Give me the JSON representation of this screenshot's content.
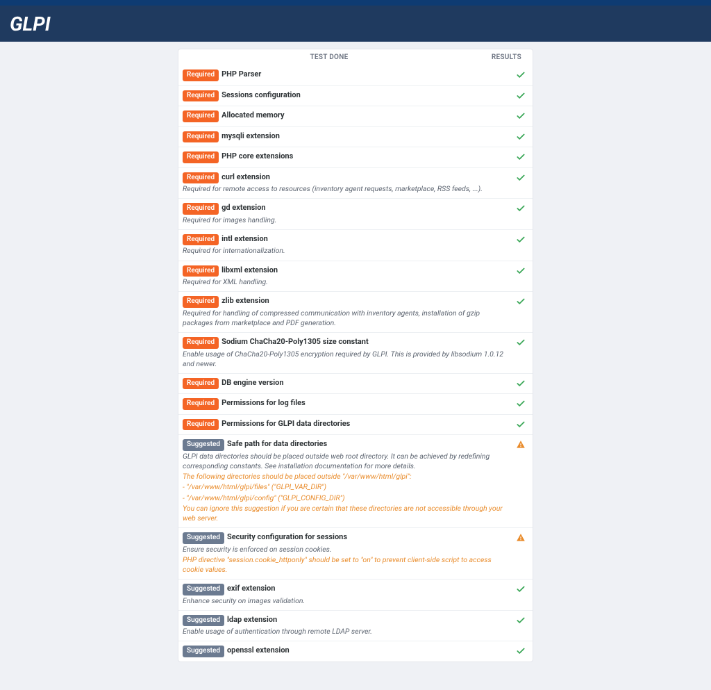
{
  "brand": "GLPI",
  "columns": {
    "test": "TEST DONE",
    "results": "RESULTS"
  },
  "badges": {
    "required": "Required",
    "suggested": "Suggested"
  },
  "rows": [
    {
      "type": "required",
      "title": "PHP Parser",
      "status": "ok"
    },
    {
      "type": "required",
      "title": "Sessions configuration",
      "status": "ok"
    },
    {
      "type": "required",
      "title": "Allocated memory",
      "status": "ok"
    },
    {
      "type": "required",
      "title": "mysqli extension",
      "status": "ok"
    },
    {
      "type": "required",
      "title": "PHP core extensions",
      "status": "ok"
    },
    {
      "type": "required",
      "title": "curl extension",
      "status": "ok",
      "desc": "Required for remote access to resources (inventory agent requests, marketplace, RSS feeds, ...)."
    },
    {
      "type": "required",
      "title": "gd extension",
      "status": "ok",
      "desc": "Required for images handling."
    },
    {
      "type": "required",
      "title": "intl extension",
      "status": "ok",
      "desc": "Required for internationalization."
    },
    {
      "type": "required",
      "title": "libxml extension",
      "status": "ok",
      "desc": "Required for XML handling."
    },
    {
      "type": "required",
      "title": "zlib extension",
      "status": "ok",
      "desc": "Required for handling of compressed communication with inventory agents, installation of gzip packages from marketplace and PDF generation."
    },
    {
      "type": "required",
      "title": "Sodium ChaCha20-Poly1305 size constant",
      "status": "ok",
      "desc": "Enable usage of ChaCha20-Poly1305 encryption required by GLPI. This is provided by libsodium 1.0.12 and newer."
    },
    {
      "type": "required",
      "title": "DB engine version",
      "status": "ok"
    },
    {
      "type": "required",
      "title": "Permissions for log files",
      "status": "ok"
    },
    {
      "type": "required",
      "title": "Permissions for GLPI data directories",
      "status": "ok"
    },
    {
      "type": "suggested",
      "title": "Safe path for data directories",
      "status": "warn",
      "desc": "GLPI data directories should be placed outside web root directory. It can be achieved by redefining corresponding constants. See installation documentation for more details.",
      "warn_lines": [
        "The following directories should be placed outside \"/var/www/html/glpi\":",
        "‑ \"/var/www/html/glpi/files\" (\"GLPI_VAR_DIR\")",
        "‑ \"/var/www/html/glpi/config\" (\"GLPI_CONFIG_DIR\")",
        "You can ignore this suggestion if you are certain that these directories are not accessible through your web server."
      ]
    },
    {
      "type": "suggested",
      "title": "Security configuration for sessions",
      "status": "warn",
      "desc": "Ensure security is enforced on session cookies.",
      "warn_lines": [
        "PHP directive \"session.cookie_httponly\" should be set to \"on\" to prevent client-side script to access cookie values."
      ]
    },
    {
      "type": "suggested",
      "title": "exif extension",
      "status": "ok",
      "desc": "Enhance security on images validation."
    },
    {
      "type": "suggested",
      "title": "ldap extension",
      "status": "ok",
      "desc": "Enable usage of authentication through remote LDAP server."
    },
    {
      "type": "suggested",
      "title": "openssl extension",
      "status": "ok"
    }
  ]
}
